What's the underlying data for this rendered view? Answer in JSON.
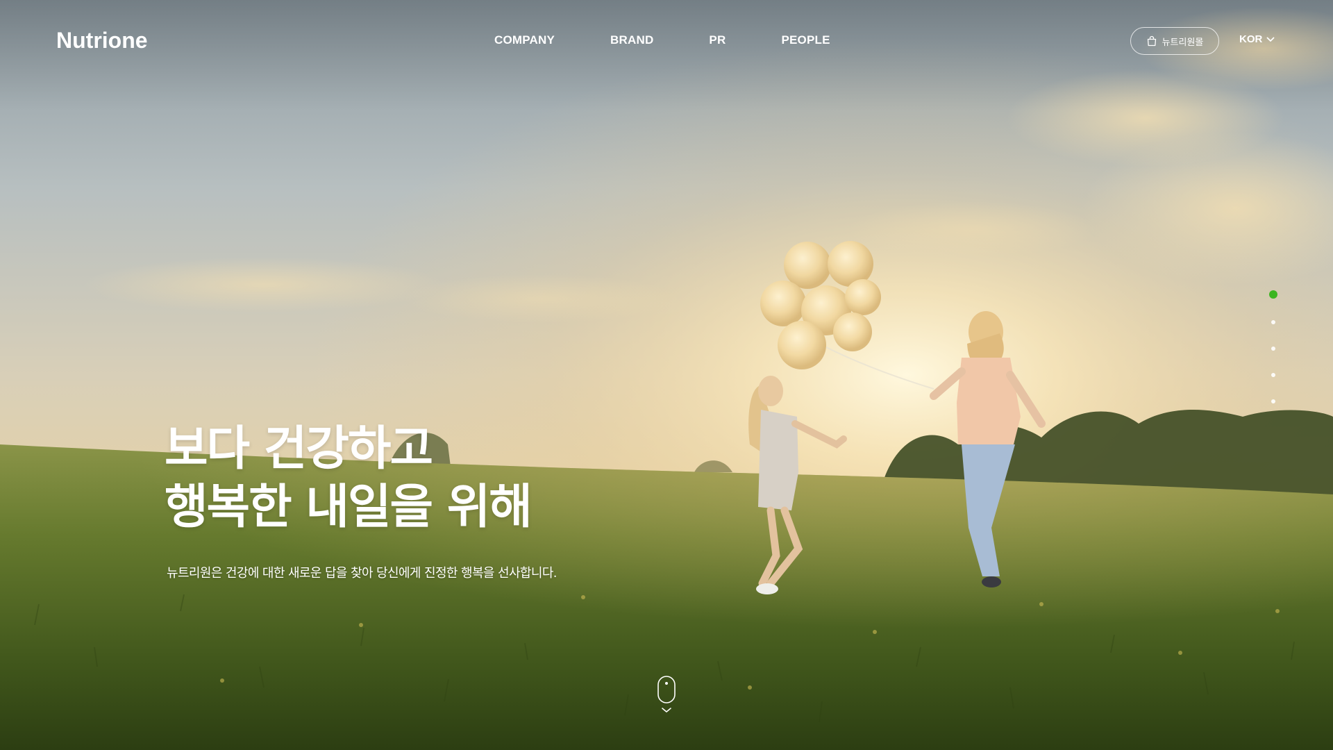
{
  "header": {
    "logo": "Nutrione",
    "nav": [
      "COMPANY",
      "BRAND",
      "PR",
      "PEOPLE"
    ],
    "mall_button": {
      "label": "뉴트리원몰",
      "icon": "shopping-bag-icon"
    },
    "language": {
      "selected": "KOR",
      "icon": "chevron-down-icon"
    }
  },
  "hero": {
    "title_line1": "보다 건강하고",
    "title_line2": "행복한 내일을 위해",
    "description": "뉴트리원은 건강에 대한 새로운 답을 찾아 당신에게 진정한 행복을 선사합니다."
  },
  "pager": {
    "slide_count": 5,
    "active_index": 0
  },
  "scroll": {
    "icon": "mouse-scroll-icon"
  },
  "colors": {
    "accent": "#3cb521",
    "text": "#ffffff"
  }
}
